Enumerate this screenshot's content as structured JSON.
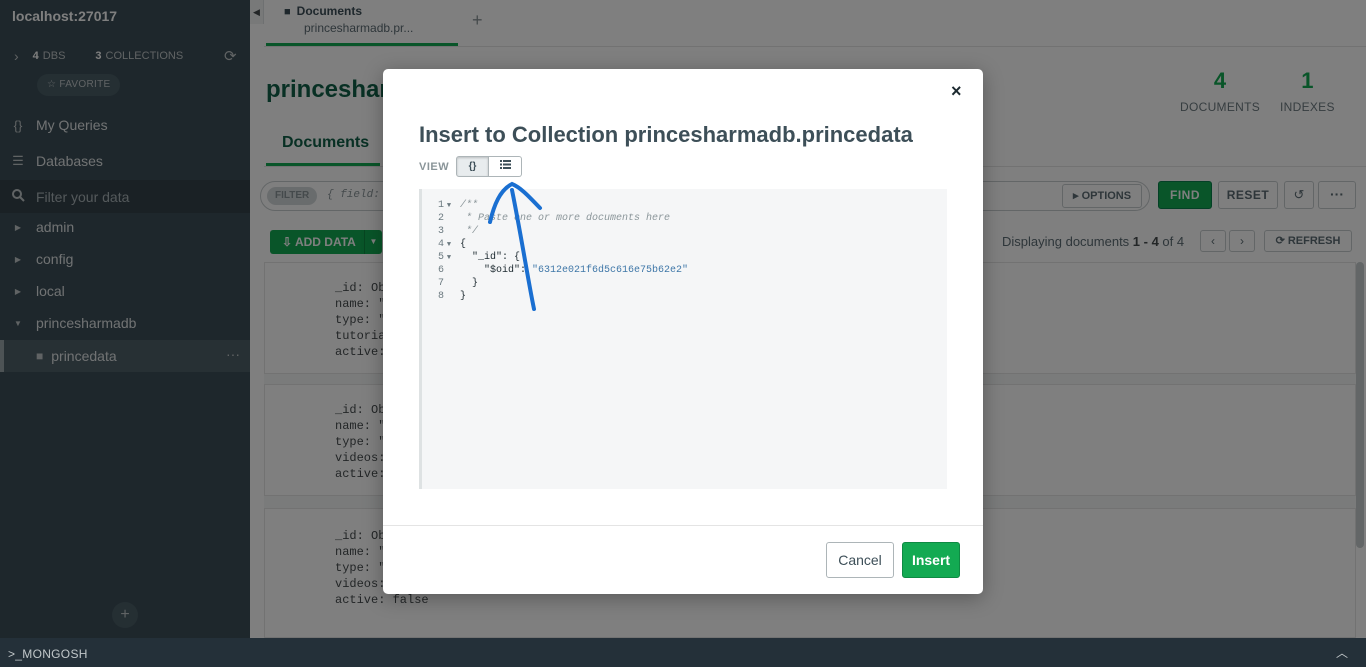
{
  "sidebar": {
    "host": "localhost:27017",
    "dbs_count": "4",
    "dbs_label": "DBS",
    "collections_count": "3",
    "collections_label": "COLLECTIONS",
    "favorite": "☆ FAVORITE",
    "my_queries": "My Queries",
    "databases": "Databases",
    "filter_placeholder": "Filter your data",
    "db_list": [
      "admin",
      "config",
      "local",
      "princesharmadb"
    ],
    "active_collection": "princedata"
  },
  "mongosh": {
    "label": ">_MONGOSH"
  },
  "tab": {
    "title": "Documents",
    "subtitle": "princesharmadb.pr..."
  },
  "collection": {
    "title": "princeshar",
    "documents_count": "4",
    "documents_label": "DOCUMENTS",
    "indexes_count": "1",
    "indexes_label": "INDEXES",
    "subtab": "Documents"
  },
  "toolbar": {
    "filter_pill": "FILTER",
    "filter_placeholder": "{ field:",
    "options": "OPTIONS",
    "find": "FIND",
    "reset": "RESET",
    "add_data": "ADD DATA",
    "displaying_prefix": "Displaying documents ",
    "displaying_range": "1 - 4",
    "displaying_suffix": " of 4",
    "refresh": "REFRESH"
  },
  "documents": [
    {
      "lines": [
        "_id: Ob",
        "name: \"",
        "type: \"",
        "tutoria",
        "active:"
      ]
    },
    {
      "lines": [
        "_id: Ob",
        "name: \"",
        "type: \"",
        "videos:",
        "active:"
      ]
    },
    {
      "lines": [
        "_id: Ob",
        "name: \"",
        "type: \"",
        "videos:",
        "active: false"
      ]
    }
  ],
  "modal": {
    "title": "Insert to Collection princesharmadb.princedata",
    "view_label": "VIEW",
    "json_view_label": "{}",
    "cancel": "Cancel",
    "insert": "Insert",
    "editor_lines": [
      {
        "n": "1",
        "fold": true,
        "cm": "/**",
        "parts": []
      },
      {
        "n": "2",
        "fold": false,
        "cm": " * Paste one or more documents here",
        "parts": []
      },
      {
        "n": "3",
        "fold": false,
        "cm": " */",
        "parts": []
      },
      {
        "n": "4",
        "fold": true,
        "cm": "",
        "txt": "{"
      },
      {
        "n": "5",
        "fold": true,
        "cm": "",
        "txt": "  \"_id\": {"
      },
      {
        "n": "6",
        "fold": false,
        "cm": "",
        "txt": "    \"$oid\": ",
        "str": "\"6312e021f6d5c616e75b62e2\""
      },
      {
        "n": "7",
        "fold": false,
        "cm": "",
        "txt": "  }"
      },
      {
        "n": "8",
        "fold": false,
        "cm": "",
        "txt": "}"
      }
    ]
  },
  "colors": {
    "sidebar_bg": "#3d4f58",
    "accent_green": "#13aa52",
    "title_green": "#116149",
    "annotation_blue": "#1a6fd1"
  }
}
